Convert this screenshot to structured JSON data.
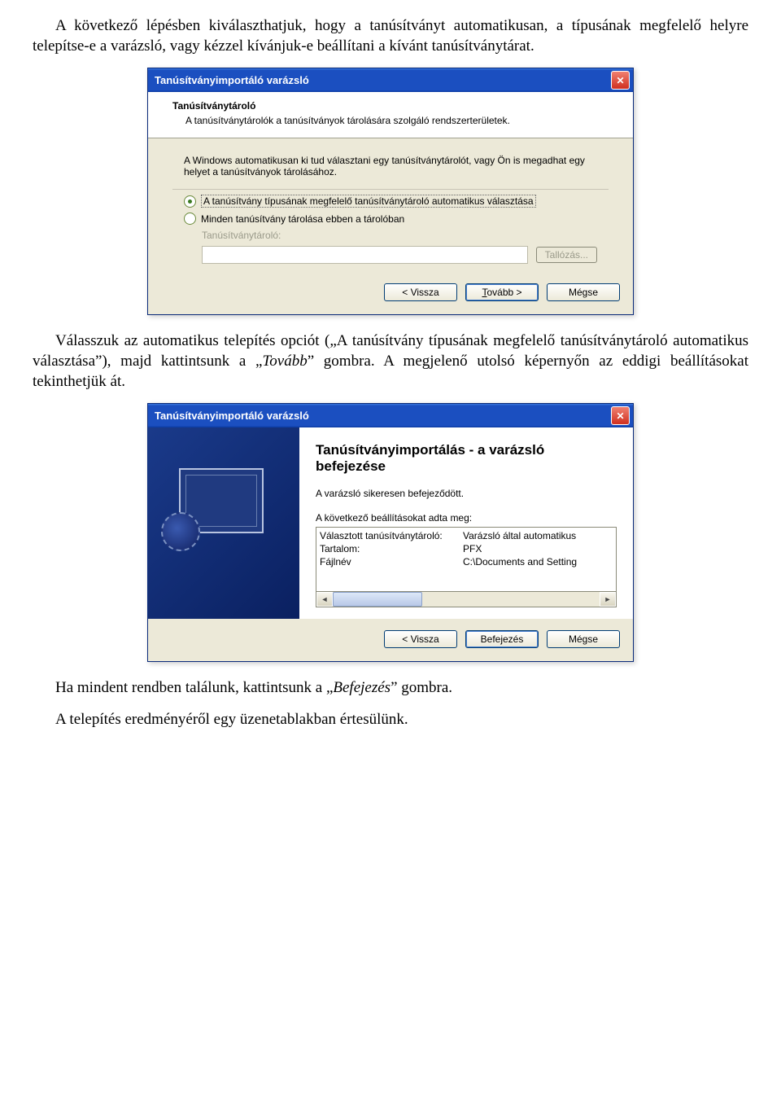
{
  "doc": {
    "para1_full": "A következő lépésben kiválaszthatjuk, hogy a tanúsítványt automatikusan, a típusának megfelelő helyre telepítse-e a varázsló, vagy kézzel kívánjuk-e beállítani a kívánt tanúsítványtárat.",
    "para2_a": "Válasszuk az automatikus telepítés opciót („A tanúsítvány típusának megfelelő tanúsítványtároló automatikus választása”), majd kattintsunk a „",
    "para2_i1": "Tovább",
    "para2_b": "” gombra. A megjelenő utolsó képernyőn az eddigi beállításokat tekinthetjük át.",
    "para3_a": "Ha mindent rendben találunk, kattintsunk a „",
    "para3_i1": "Befejezés",
    "para3_b": "” gombra.",
    "para4": "A telepítés eredményéről egy üzenetablakban értesülünk."
  },
  "dialog1": {
    "title": "Tanúsítványimportáló varázsló",
    "header_title": "Tanúsítványtároló",
    "header_desc": "A tanúsítványtárolók a tanúsítványok tárolására szolgáló rendszerterületek.",
    "intro": "A Windows automatikusan ki tud választani egy tanúsítványtárolót, vagy Ön is megadhat egy helyet a tanúsítványok tárolásához.",
    "radio1": "A tanúsítvány típusának megfelelő tanúsítványtároló automatikus választása",
    "radio2": "Minden tanúsítvány tárolása ebben a tárolóban",
    "store_label": "Tanúsítványtároló:",
    "browse": "Tallózás...",
    "back": "< Vissza",
    "next_plain": "Tovább >",
    "next_key": "T",
    "cancel": "Mégse"
  },
  "dialog2": {
    "title": "Tanúsítványimportáló varázsló",
    "heading": "Tanúsítványimportálás - a varázsló befejezése",
    "success": "A varázsló sikeresen befejeződött.",
    "settings_label": "A következő beállításokat adta meg:",
    "rows": {
      "k1": "Választott tanúsítványtároló:",
      "v1": "Varázsló által automatikus",
      "k2": "Tartalom:",
      "v2": "PFX",
      "k3": "Fájlnév",
      "v3": "C:\\Documents and Setting"
    },
    "back": "< Vissza",
    "finish": "Befejezés",
    "cancel": "Mégse"
  }
}
